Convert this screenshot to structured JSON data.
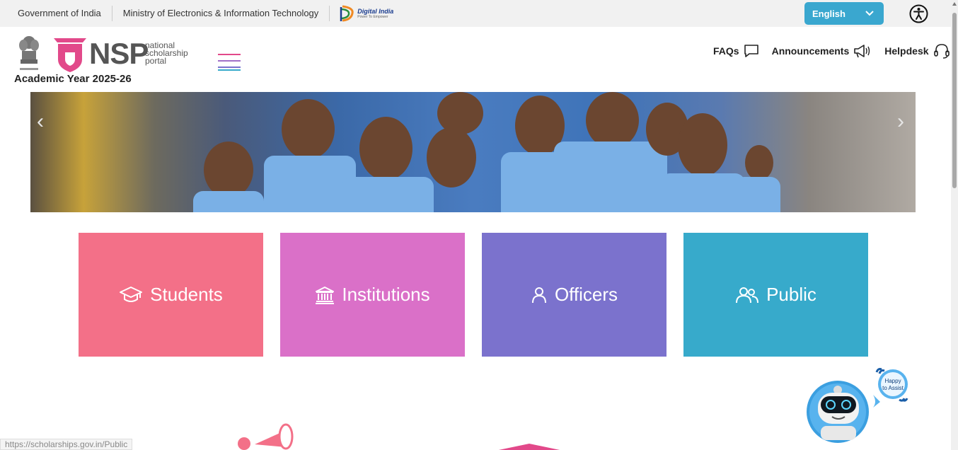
{
  "govbar": {
    "items": [
      "Government of India",
      "Ministry of Electronics & Information Technology"
    ],
    "digital_india": "Digital India",
    "digital_india_sub": "Power To Empower",
    "language": "English"
  },
  "header": {
    "logo_text": "NSP",
    "logo_sub": [
      "national",
      "scholarship",
      "portal"
    ],
    "academic_year": "Academic Year 2025-26"
  },
  "nav": [
    {
      "label": "FAQs",
      "icon": "chat-icon"
    },
    {
      "label": "Announcements",
      "icon": "megaphone-icon"
    },
    {
      "label": "Helpdesk",
      "icon": "headset-icon"
    }
  ],
  "tiles": [
    {
      "label": "Students",
      "icon": "graduation-cap-icon",
      "color": "#f37088"
    },
    {
      "label": "Institutions",
      "icon": "institution-icon",
      "color": "#da70c8"
    },
    {
      "label": "Officers",
      "icon": "officer-icon",
      "color": "#7b72cd"
    },
    {
      "label": "Public",
      "icon": "users-icon",
      "color": "#37aacb"
    }
  ],
  "chatbot": {
    "bubble": [
      "Happy",
      "to Assist"
    ]
  },
  "status_url": "https://scholarships.gov.in/Public",
  "colors": {
    "accent": "#3aa7cf",
    "brand_pink": "#e2498a"
  }
}
